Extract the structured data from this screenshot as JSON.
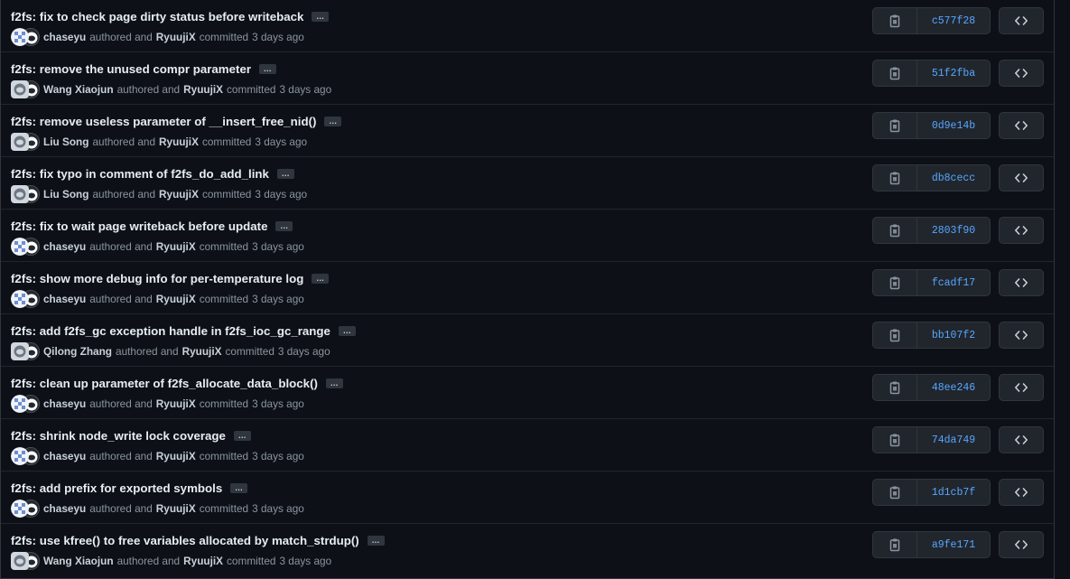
{
  "ui": {
    "authored_text": "authored and",
    "committed_text": "committed",
    "ellipsis": "…",
    "icons": {
      "copy": "clipboard-icon",
      "browse": "code-icon",
      "author_avatar_chaseyu": "identicon",
      "avatar_default": "github-octocat"
    },
    "colors": {
      "background": "#0d1117",
      "sha_link": "#58a6ff",
      "button_bg": "#21262d",
      "border": "#30363d"
    }
  },
  "commits": [
    {
      "title": "f2fs: fix to check page dirty status before writeback",
      "author": "chaseyu",
      "committer": "RyuujiX",
      "time": "3 days ago",
      "sha": "c577f28",
      "avatar_kind": "identicon"
    },
    {
      "title": "f2fs: remove the unused compr parameter",
      "author": "Wang Xiaojun",
      "committer": "RyuujiX",
      "time": "3 days ago",
      "sha": "51f2fba",
      "avatar_kind": "default"
    },
    {
      "title": "f2fs: remove useless parameter of __insert_free_nid()",
      "author": "Liu Song",
      "committer": "RyuujiX",
      "time": "3 days ago",
      "sha": "0d9e14b",
      "avatar_kind": "default"
    },
    {
      "title": "f2fs: fix typo in comment of f2fs_do_add_link",
      "author": "Liu Song",
      "committer": "RyuujiX",
      "time": "3 days ago",
      "sha": "db8cecc",
      "avatar_kind": "default"
    },
    {
      "title": "f2fs: fix to wait page writeback before update",
      "author": "chaseyu",
      "committer": "RyuujiX",
      "time": "3 days ago",
      "sha": "2803f90",
      "avatar_kind": "identicon"
    },
    {
      "title": "f2fs: show more debug info for per-temperature log",
      "author": "chaseyu",
      "committer": "RyuujiX",
      "time": "3 days ago",
      "sha": "fcadf17",
      "avatar_kind": "identicon"
    },
    {
      "title": "f2fs: add f2fs_gc exception handle in f2fs_ioc_gc_range",
      "author": "Qilong Zhang",
      "committer": "RyuujiX",
      "time": "3 days ago",
      "sha": "bb107f2",
      "avatar_kind": "default"
    },
    {
      "title": "f2fs: clean up parameter of f2fs_allocate_data_block()",
      "author": "chaseyu",
      "committer": "RyuujiX",
      "time": "3 days ago",
      "sha": "48ee246",
      "avatar_kind": "identicon"
    },
    {
      "title": "f2fs: shrink node_write lock coverage",
      "author": "chaseyu",
      "committer": "RyuujiX",
      "time": "3 days ago",
      "sha": "74da749",
      "avatar_kind": "identicon"
    },
    {
      "title": "f2fs: add prefix for exported symbols",
      "author": "chaseyu",
      "committer": "RyuujiX",
      "time": "3 days ago",
      "sha": "1d1cb7f",
      "avatar_kind": "identicon"
    },
    {
      "title": "f2fs: use kfree() to free variables allocated by match_strdup()",
      "author": "Wang Xiaojun",
      "committer": "RyuujiX",
      "time": "3 days ago",
      "sha": "a9fe171",
      "avatar_kind": "default"
    }
  ]
}
